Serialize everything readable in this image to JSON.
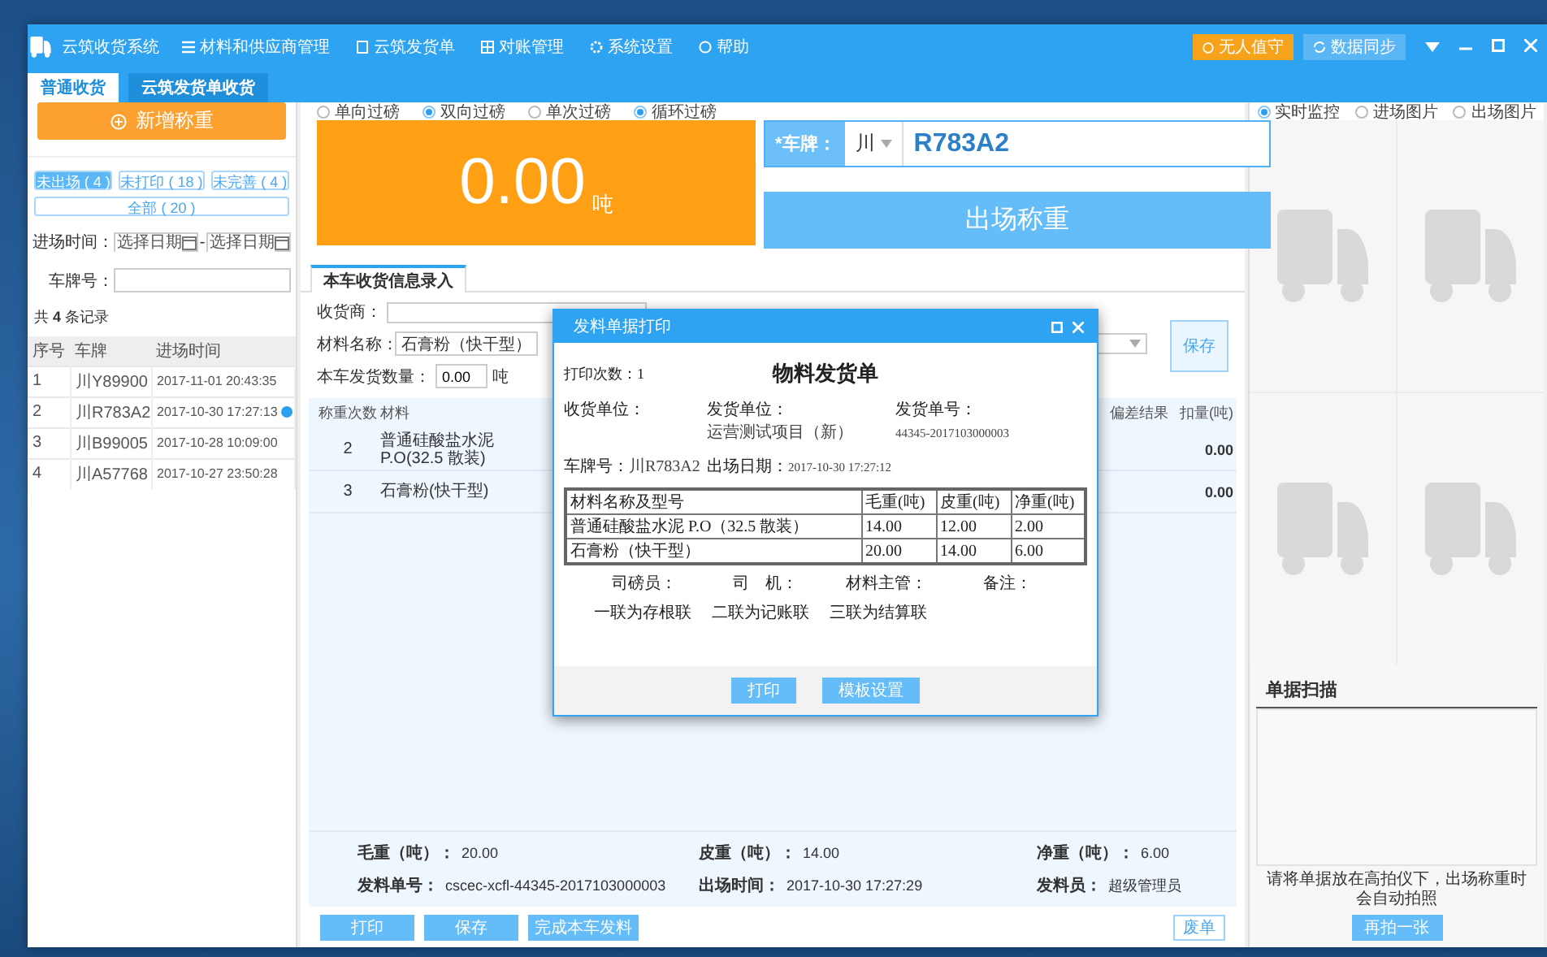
{
  "window": {
    "title": "云筑收货系统",
    "menu": [
      "材料和供应商管理",
      "云筑发货单",
      "对账管理",
      "系统设置",
      "帮助"
    ],
    "unattended_button": "无人值守",
    "sync_button": "数据同步"
  },
  "tabs": [
    {
      "label": "普通收货",
      "selected": true
    },
    {
      "label": "云筑发货单收货",
      "selected": false
    }
  ],
  "sidebar": {
    "add_button": "新增称重",
    "filters": [
      {
        "label": "未出场 ( 4 )",
        "selected": true
      },
      {
        "label": "未打印 ( 18 )",
        "selected": false
      },
      {
        "label": "未完善 ( 4 )",
        "selected": false
      },
      {
        "label": "全部 ( 20 )",
        "selected": false
      }
    ],
    "date_label": "进场时间：",
    "date_from": {
      "placeholder": "选择日期"
    },
    "date_separator": "-",
    "date_to": {
      "placeholder": "选择日期"
    },
    "plate_label": "车牌号：",
    "record_count": "共 **4** 条记录",
    "table": {
      "columns": [
        "序号",
        "车牌",
        "进场时间"
      ],
      "rows": [
        {
          "cells": [
            "1",
            "川Y89900",
            "2017-11-01 20:43:35"
          ],
          "flagged": false
        },
        {
          "cells": [
            "2",
            "川R783A2",
            "2017-10-30 17:27:13"
          ],
          "flagged": true
        },
        {
          "cells": [
            "3",
            "川B99005",
            "2017-10-28 10:09:00"
          ],
          "flagged": false
        },
        {
          "cells": [
            "4",
            "川A57768",
            "2017-10-27 23:50:28"
          ],
          "flagged": false
        }
      ]
    }
  },
  "weighing": {
    "modes": [
      [
        {
          "label": "单向过磅",
          "selected": false
        },
        {
          "label": "双向过磅",
          "selected": true
        }
      ],
      [
        {
          "label": "单次过磅",
          "selected": false
        },
        {
          "label": "循环过磅",
          "selected": true
        }
      ]
    ],
    "weight": "0.00",
    "unit": "吨",
    "plate_label": "*车牌：",
    "province": "川",
    "plate": "R783A2",
    "exit_button": "出场称重"
  },
  "entry": {
    "tab": "本车收货信息录入",
    "receiver_label": "收货商：",
    "material_label": "材料名称：",
    "material": "石膏粉（快干型）",
    "quantity_label": "本车发货数量：",
    "quantity": "0.00",
    "quantity_unit": "吨",
    "save_button": "保存",
    "table": {
      "columns": [
        "称重次数",
        "材料",
        "偏差结果",
        "扣量(吨)"
      ],
      "rows": [
        {
          "count": "2",
          "material": "普通硅酸盐水泥 P.O(32.5 散装)",
          "deduction": "0.00"
        },
        {
          "count": "3",
          "material": "石膏粉(快干型)",
          "deduction": "0.00"
        }
      ]
    }
  },
  "summary": [
    {
      "label": "毛重（吨）：",
      "value": "20.00"
    },
    {
      "label": "皮重（吨）：",
      "value": "14.00"
    },
    {
      "label": "净重（吨）：",
      "value": "6.00"
    },
    {
      "label": "发料单号：",
      "value": "cscec-xcfl-44345-2017103000003"
    },
    {
      "label": "出场时间：",
      "value": "2017-10-30 17:27:29"
    },
    {
      "label": "发料员：",
      "value": "超级管理员"
    }
  ],
  "actions": [
    "打印",
    "保存",
    "完成本车发料"
  ],
  "void_button": "废单",
  "dialog": {
    "title": "发料单据打印",
    "print_count": "打印次数：1",
    "heading": "物料发货单",
    "fields": [
      {
        "label": "收货单位："
      },
      {
        "label": "发货单位：",
        "value": "运营测试项目（新）"
      },
      {
        "label": "发货单号：",
        "value": "44345-2017103000003"
      },
      {
        "label": "车牌号：",
        "value": "川R783A2"
      },
      {
        "label": "出场日期：",
        "value": "2017-10-30 17:27:12"
      }
    ],
    "table": {
      "columns": [
        "材料名称及型号",
        "毛重(吨)",
        "皮重(吨)",
        "净重(吨)"
      ],
      "rows": [
        [
          "普通硅酸盐水泥 P.O（32.5 散装）",
          "14.00",
          "12.00",
          "2.00"
        ],
        [
          "石膏粉（快干型）",
          "20.00",
          "14.00",
          "6.00"
        ]
      ]
    },
    "signatures": [
      "司磅员：",
      "司　机：",
      "材料主管：",
      "备注："
    ],
    "copies": [
      "一联为存根联",
      "二联为记账联",
      "三联为结算联"
    ],
    "buttons": [
      "打印",
      "模板设置"
    ]
  },
  "monitor": {
    "views": [
      {
        "label": "实时监控",
        "selected": true
      },
      {
        "label": "进场图片",
        "selected": false
      },
      {
        "label": "出场图片",
        "selected": false
      }
    ],
    "scan_title": "单据扫描",
    "scan_hint": "请将单据放在高拍仪下，出场称重时会自动拍照",
    "retake_button": "再拍一张"
  }
}
